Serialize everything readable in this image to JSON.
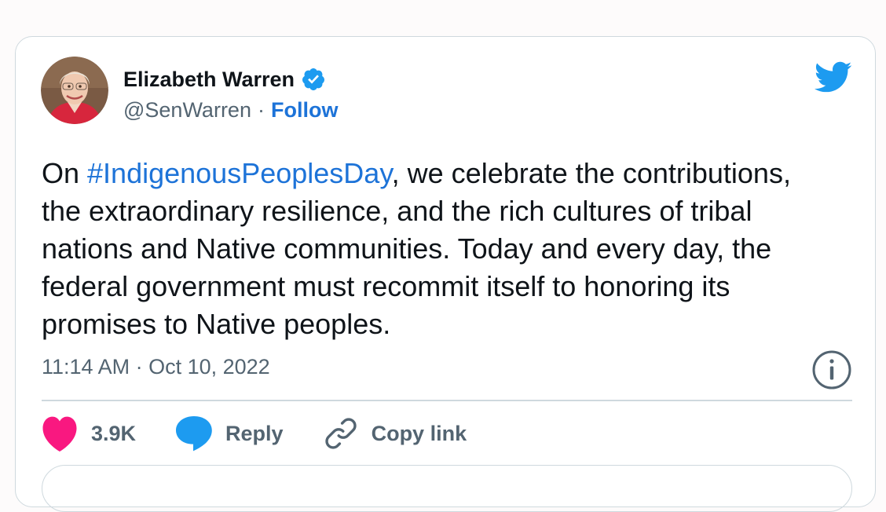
{
  "tweet": {
    "author_name": "Elizabeth Warren",
    "handle": "@SenWarren",
    "separator": "·",
    "follow_label": "Follow",
    "text_before": "On ",
    "hashtag": "#IndigenousPeoplesDay",
    "text_after": ", we celebrate the contributions, the extraordinary resilience, and the rich cultures of tribal nations and Native communities. Today and every day, the federal government must recommit itself to honoring its promises to Native peoples.",
    "timestamp": "11:14 AM · Oct 10, 2022"
  },
  "actions": {
    "like_count": "3.9K",
    "reply_label": "Reply",
    "copy_link_label": "Copy link"
  },
  "icons": {
    "verified": "verified-badge-icon",
    "bird": "twitter-bird-icon",
    "info": "info-icon",
    "heart": "heart-icon",
    "reply": "reply-bubble-icon",
    "link": "link-icon"
  },
  "colors": {
    "link_blue": "#1d73d8",
    "twitter_blue": "#1d9bf0",
    "like_pink": "#f91880",
    "muted_text": "#536471",
    "main_text": "#0f1419",
    "border": "#cfd9de"
  }
}
